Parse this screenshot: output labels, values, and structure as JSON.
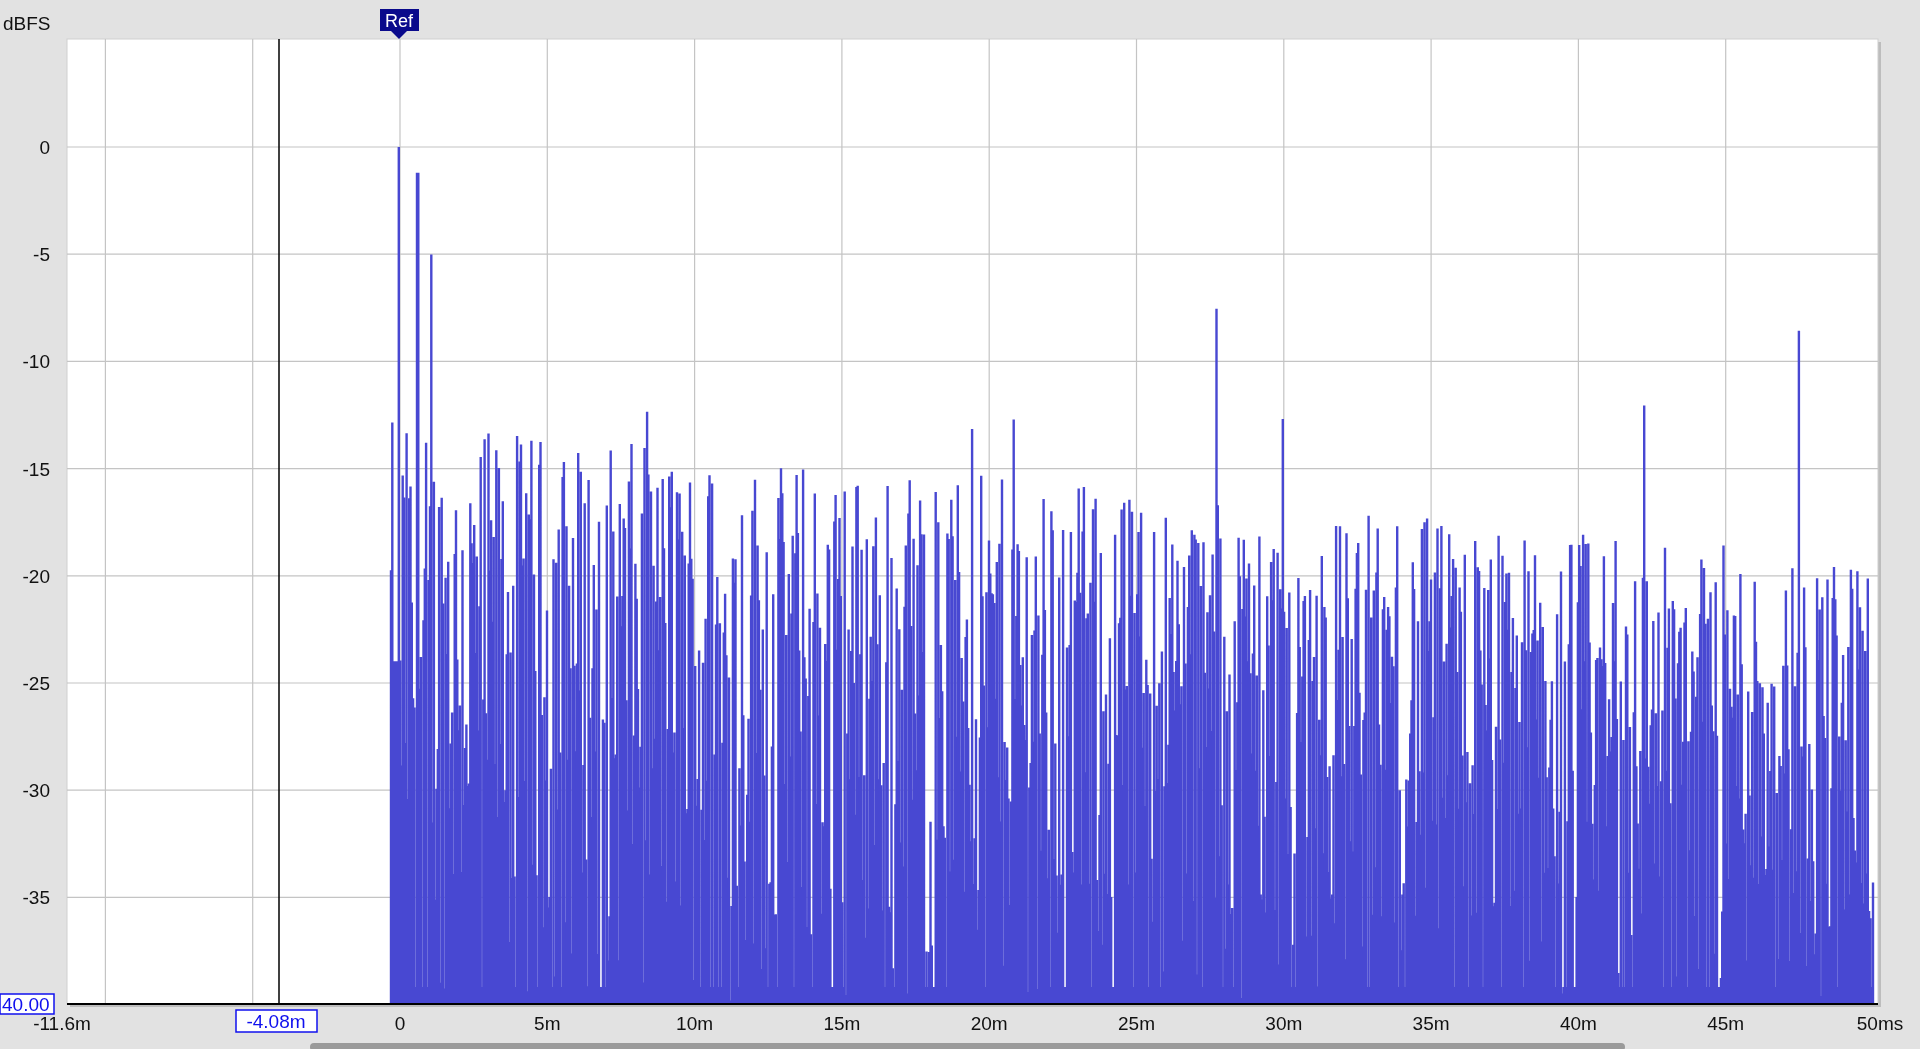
{
  "y_axis": {
    "unit": "dBFS",
    "ticks": [
      "0",
      "-5",
      "-10",
      "-15",
      "-20",
      "-25",
      "-30",
      "-35"
    ]
  },
  "x_axis": {
    "ticks": [
      "-11.6m",
      "0",
      "5m",
      "10m",
      "15m",
      "20m",
      "25m",
      "30m",
      "35m",
      "40m",
      "45m",
      "50ms"
    ]
  },
  "reference_marker": {
    "label": "Ref"
  },
  "cursor": {
    "x_readout": "-4.08m",
    "y_readout": "40.00"
  }
}
